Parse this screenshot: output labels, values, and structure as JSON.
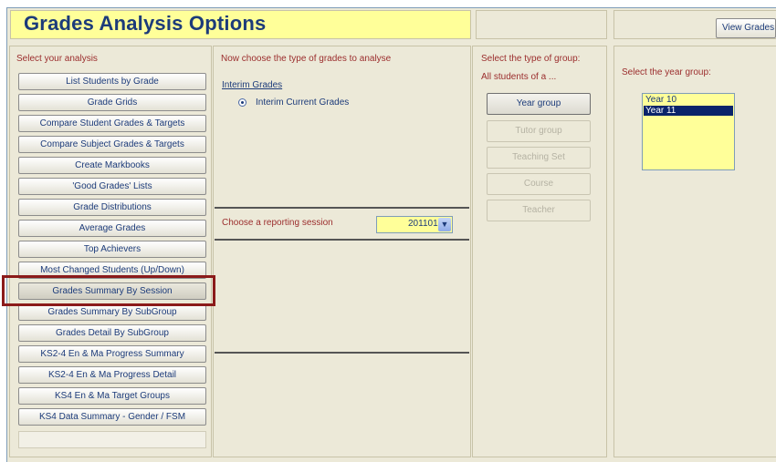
{
  "header": {
    "title": "Grades Analysis Options",
    "view_button": "View Grades"
  },
  "analysis": {
    "heading": "Select your analysis",
    "items": [
      "List Students by Grade",
      "Grade Grids",
      "Compare Student Grades & Targets",
      "Compare Subject Grades & Targets",
      "Create Markbooks",
      "'Good Grades' Lists",
      "Grade Distributions",
      "Average Grades",
      "Top Achievers",
      "Most Changed Students (Up/Down)",
      "Grades Summary By Session",
      "Grades Summary By SubGroup",
      "Grades Detail By SubGroup",
      "KS2-4 En & Ma Progress Summary",
      "KS2-4 En & Ma Progress Detail",
      "KS4 En & Ma Target Groups",
      "KS4 Data Summary - Gender / FSM"
    ],
    "selected": "Grades Summary By Session"
  },
  "grade_type": {
    "heading": "Now choose the type of grades to analyse",
    "section_label": "Interim Grades",
    "option": "Interim Current Grades",
    "session_label": "Choose a reporting session",
    "session_value": "201101"
  },
  "group_type": {
    "heading": "Select the type of group:",
    "subheading": "All students of a ...",
    "buttons": [
      "Year group",
      "Tutor group",
      "Teaching Set",
      "Course",
      "Teacher"
    ]
  },
  "year_group": {
    "heading": "Select the year group:",
    "items": [
      "Year 10",
      "Year 11"
    ],
    "selected": "Year 11"
  },
  "colors": {
    "title_bg": "#ffff99",
    "title_text": "#1c3b7a",
    "highlight_border": "#8b1a1a",
    "list_selected_bg": "#0a246a"
  }
}
